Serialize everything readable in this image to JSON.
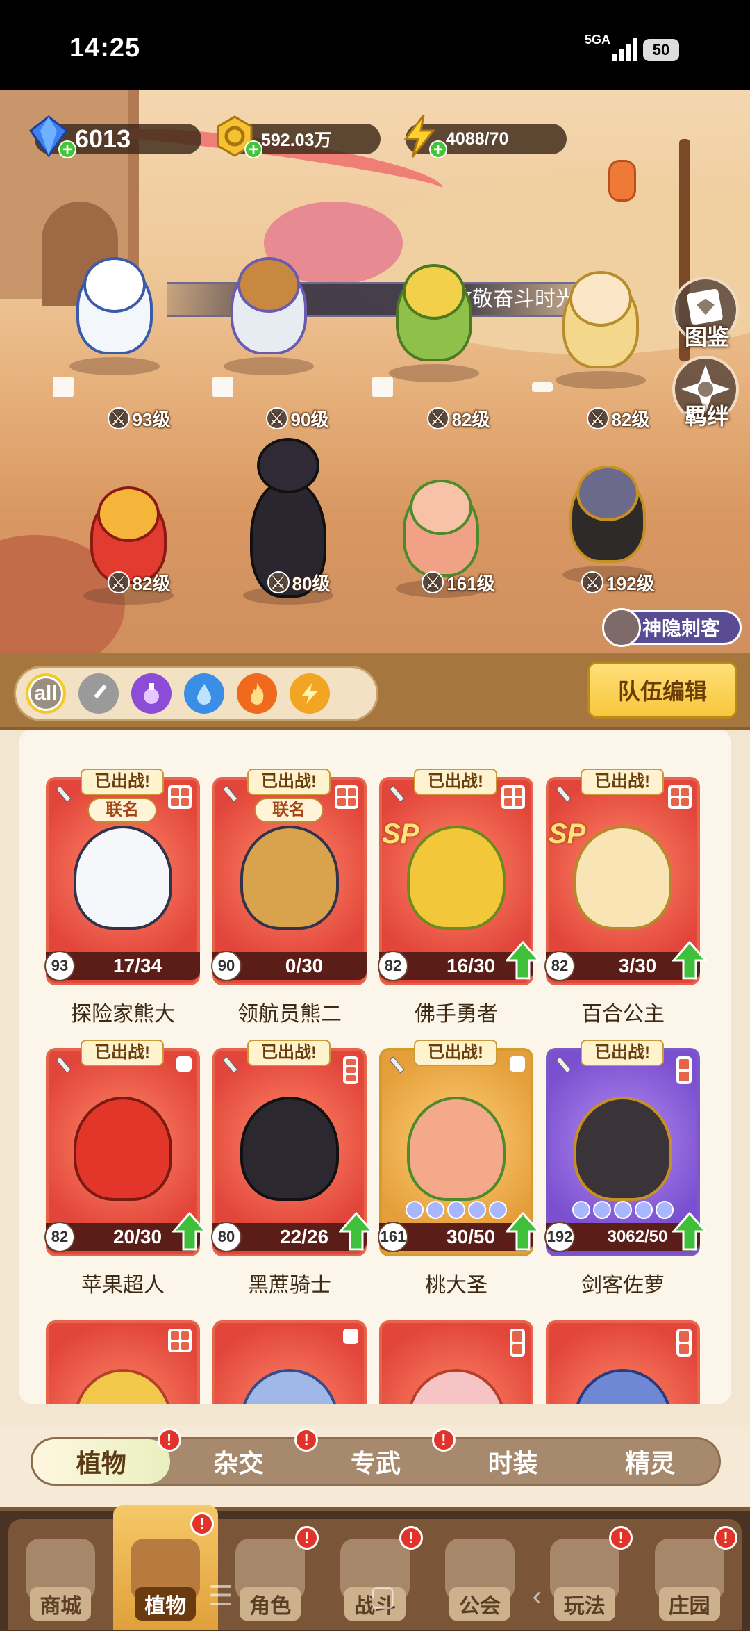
{
  "status_bar": {
    "time": "14:25",
    "network": "5GA",
    "battery": "50"
  },
  "resources": {
    "gems": "6013",
    "gold": "592.03万",
    "energy": "4088/70"
  },
  "banner": {
    "text": "致敬奋斗时光"
  },
  "side_buttons": {
    "atlas": "图鉴",
    "bond": "羁绊"
  },
  "lineup": [
    {
      "name": "探险家熊大",
      "level": "93级"
    },
    {
      "name": "领航员熊二",
      "level": "90级"
    },
    {
      "name": "佛手勇者",
      "level": "82级"
    },
    {
      "name": "百合公主",
      "level": "82级"
    },
    {
      "name": "苹果超人",
      "level": "82级"
    },
    {
      "name": "黑蔗骑士",
      "level": "80级"
    },
    {
      "name": "桃大圣",
      "level": "161级"
    },
    {
      "name": "剑客佐萝",
      "level": "192级"
    }
  ],
  "ninja_badge": "神隐刺客",
  "filter": {
    "all_label": "all",
    "team_edit": "队伍编辑"
  },
  "cards": [
    {
      "name": "探险家熊大",
      "level": "93",
      "frags": "17/34",
      "deployed": "已出战!",
      "tag": "联名"
    },
    {
      "name": "领航员熊二",
      "level": "90",
      "frags": "0/30",
      "deployed": "已出战!",
      "tag": "联名"
    },
    {
      "name": "佛手勇者",
      "level": "82",
      "frags": "16/30",
      "deployed": "已出战!",
      "tag": "SP"
    },
    {
      "name": "百合公主",
      "level": "82",
      "frags": "3/30",
      "deployed": "已出战!",
      "tag": "SP"
    },
    {
      "name": "苹果超人",
      "level": "82",
      "frags": "20/30",
      "deployed": "已出战!"
    },
    {
      "name": "黑蔗骑士",
      "level": "80",
      "frags": "22/26",
      "deployed": "已出战!"
    },
    {
      "name": "桃大圣",
      "level": "161",
      "frags": "30/50",
      "deployed": "已出战!"
    },
    {
      "name": "剑客佐萝",
      "level": "192",
      "frags": "3062/50",
      "deployed": "已出战!"
    }
  ],
  "category_tabs": [
    "植物",
    "杂交",
    "专武",
    "时装",
    "精灵"
  ],
  "bottom_nav": [
    "商城",
    "植物",
    "角色",
    "战斗",
    "公会",
    "玩法",
    "庄园"
  ],
  "badge_mark": "!",
  "colors": {
    "card_red": "#e66449",
    "card_gold": "#d49b2d",
    "card_purple": "#7b5ac8",
    "accent_yellow": "#f8c63a",
    "upgrade_green": "#3fbf3a"
  }
}
